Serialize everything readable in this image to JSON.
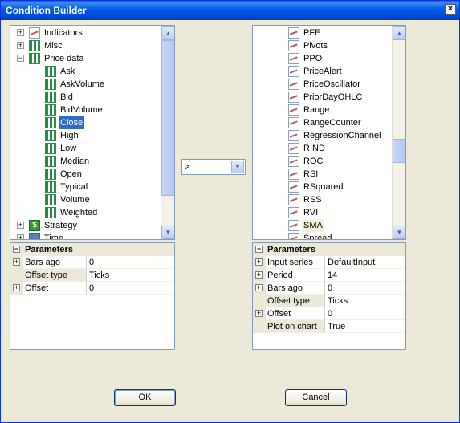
{
  "window": {
    "title": "Condition Builder",
    "close_glyph": "×"
  },
  "left_tree": {
    "items": [
      {
        "label": "Indicators",
        "type": "category",
        "icon": "indicator-chart-icon",
        "expander": "+"
      },
      {
        "label": "Misc",
        "type": "category",
        "icon": "bar-chart-icon",
        "expander": "+"
      },
      {
        "label": "Price data",
        "type": "category",
        "icon": "bar-chart-icon",
        "expander": "−"
      },
      {
        "label": "Ask",
        "type": "leaf",
        "icon": "bar-chart-icon"
      },
      {
        "label": "AskVolume",
        "type": "leaf",
        "icon": "bar-chart-icon"
      },
      {
        "label": "Bid",
        "type": "leaf",
        "icon": "bar-chart-icon"
      },
      {
        "label": "BidVolume",
        "type": "leaf",
        "icon": "bar-chart-icon"
      },
      {
        "label": "Close",
        "type": "leaf",
        "icon": "bar-chart-icon",
        "selected": true
      },
      {
        "label": "High",
        "type": "leaf",
        "icon": "bar-chart-icon"
      },
      {
        "label": "Low",
        "type": "leaf",
        "icon": "bar-chart-icon"
      },
      {
        "label": "Median",
        "type": "leaf",
        "icon": "bar-chart-icon"
      },
      {
        "label": "Open",
        "type": "leaf",
        "icon": "bar-chart-icon"
      },
      {
        "label": "Typical",
        "type": "leaf",
        "icon": "bar-chart-icon"
      },
      {
        "label": "Volume",
        "type": "leaf",
        "icon": "bar-chart-icon"
      },
      {
        "label": "Weighted",
        "type": "leaf",
        "icon": "bar-chart-icon"
      },
      {
        "label": "Strategy",
        "type": "category",
        "icon": "dollar-icon",
        "expander": "+"
      },
      {
        "label": "Time",
        "type": "category",
        "icon": "calendar-icon",
        "expander": "+"
      }
    ]
  },
  "left_params": {
    "header": "Parameters",
    "rows": [
      {
        "name": "Bars ago",
        "value": "0",
        "expandable": true
      },
      {
        "name": "Offset type",
        "value": "Ticks",
        "expandable": false
      },
      {
        "name": "Offset",
        "value": "0",
        "expandable": true
      }
    ]
  },
  "operator": {
    "value": ">"
  },
  "right_tree": {
    "items": [
      {
        "label": "PFE"
      },
      {
        "label": "Pivots"
      },
      {
        "label": "PPO"
      },
      {
        "label": "PriceAlert"
      },
      {
        "label": "PriceOscillator"
      },
      {
        "label": "PriorDayOHLC"
      },
      {
        "label": "Range"
      },
      {
        "label": "RangeCounter"
      },
      {
        "label": "RegressionChannel"
      },
      {
        "label": "RIND"
      },
      {
        "label": "ROC"
      },
      {
        "label": "RSI"
      },
      {
        "label": "RSquared"
      },
      {
        "label": "RSS"
      },
      {
        "label": "RVI"
      },
      {
        "label": "SMA",
        "hover": true
      },
      {
        "label": "Spread"
      }
    ]
  },
  "right_params": {
    "header": "Parameters",
    "rows": [
      {
        "name": "Input series",
        "value": "DefaultInput",
        "expandable": true
      },
      {
        "name": "Period",
        "value": "14",
        "expandable": true
      },
      {
        "name": "Bars ago",
        "value": "0",
        "expandable": true
      },
      {
        "name": "Offset type",
        "value": "Ticks",
        "expandable": false
      },
      {
        "name": "Offset",
        "value": "0",
        "expandable": true
      },
      {
        "name": "Plot on chart",
        "value": "True",
        "expandable": false
      }
    ]
  },
  "buttons": {
    "ok": "OK",
    "cancel": "Cancel"
  },
  "colors": {
    "selection": "#316ac5",
    "titlebar": "#0058e6",
    "dialog_bg": "#ece9d8"
  }
}
